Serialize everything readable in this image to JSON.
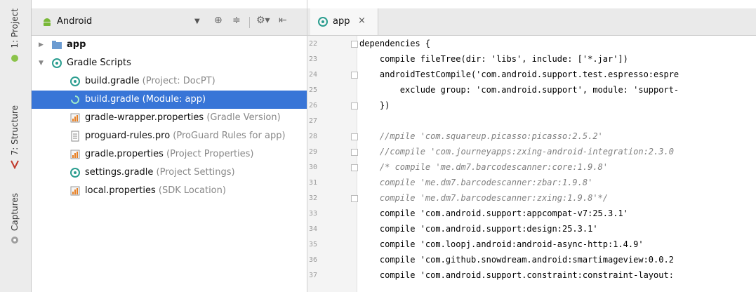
{
  "tool_strip": {
    "project_label": "1: Project",
    "structure_label": "7: Structure",
    "captures_label": "Captures"
  },
  "project_panel": {
    "view_selector": "Android",
    "tree": [
      {
        "name": "app",
        "detail": "",
        "icon": "module-folder-icon",
        "expanded": false
      },
      {
        "name": "Gradle Scripts",
        "detail": "",
        "icon": "gradle-icon",
        "expanded": true
      },
      {
        "name": "build.gradle",
        "detail": " (Project: DocPT)",
        "icon": "gradle-file-icon"
      },
      {
        "name": "build.gradle (Module: app)",
        "detail": "",
        "icon": "gradle-file-icon",
        "selected": true
      },
      {
        "name": "gradle-wrapper.properties",
        "detail": " (Gradle Version)",
        "icon": "properties-file-icon"
      },
      {
        "name": "proguard-rules.pro",
        "detail": " (ProGuard Rules for app)",
        "icon": "text-file-icon"
      },
      {
        "name": "gradle.properties",
        "detail": " (Project Properties)",
        "icon": "properties-file-icon"
      },
      {
        "name": "settings.gradle",
        "detail": " (Project Settings)",
        "icon": "gradle-file-icon"
      },
      {
        "name": "local.properties",
        "detail": " (SDK Location)",
        "icon": "properties-file-icon"
      }
    ]
  },
  "editor": {
    "tab_label": "app",
    "tab_close": "×",
    "line_numbers": [
      "22",
      "23",
      "24",
      "25",
      "26",
      "27",
      "28",
      "29",
      "30",
      "31",
      "32",
      "33",
      "34",
      "35",
      "36",
      "37"
    ],
    "lines": [
      "dependencies {",
      "    compile fileTree(dir: 'libs', include: ['*.jar'])",
      "    androidTestCompile('com.android.support.test.espresso:espre",
      "        exclude group: 'com.android.support', module: 'support-",
      "    })",
      "",
      "    //mpile 'com.squareup.picasso:picasso:2.5.2'",
      "    //compile 'com.journeyapps:zxing-android-integration:2.3.0",
      "    /* compile 'me.dm7.barcodescanner:core:1.9.8'",
      "    compile 'me.dm7.barcodescanner:zbar:1.9.8'",
      "    compile 'me.dm7.barcodescanner:zxing:1.9.8'*/",
      "    compile 'com.android.support:appcompat-v7:25.3.1'",
      "    compile 'com.android.support:design:25.3.1'",
      "    compile 'com.loopj.android:android-async-http:1.4.9'",
      "    compile 'com.github.snowdream.android:smartimageview:0.0.2",
      "    compile 'com.android.support.constraint:constraint-layout:"
    ]
  }
}
